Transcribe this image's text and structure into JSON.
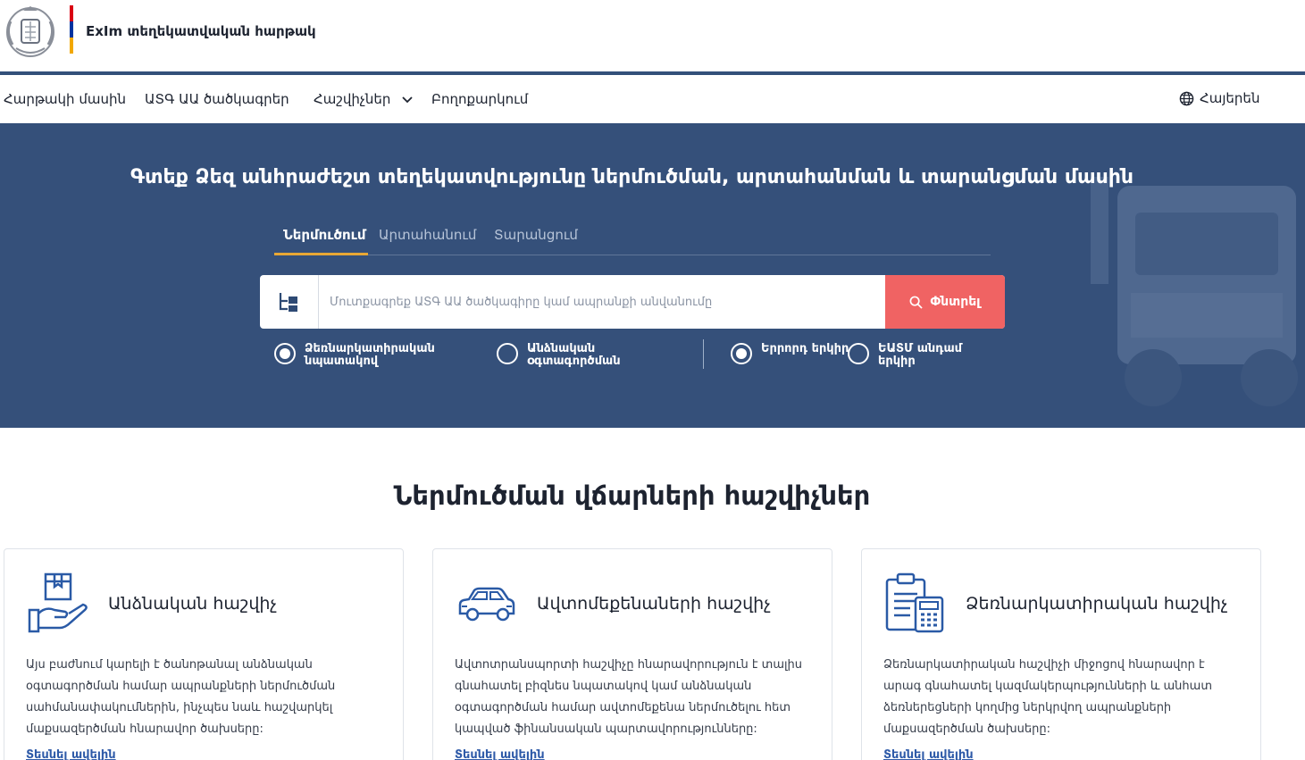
{
  "header": {
    "site_title": "ExIm տեղեկատվական հարթակ",
    "flag_colors": [
      "#d90012",
      "#0033a0",
      "#f2a800"
    ]
  },
  "nav": {
    "items": [
      {
        "label": "Հարթակի մասին"
      },
      {
        "label": "ԱՏԳ ԱԱ ծածկագրեր"
      },
      {
        "label": "Հաշվիչներ"
      },
      {
        "label": "Բողոքարկում"
      }
    ],
    "language": "Հայերեն"
  },
  "hero": {
    "title": "Գտեք Ձեզ անհրաժեշտ տեղեկատվությունը ներմուծման, արտահանման և տարանցման մասին",
    "tabs": [
      "Ներմուծում",
      "Արտահանում",
      "Տարանցում"
    ],
    "active_tab": "Ներմուծում",
    "search": {
      "placeholder": "Մուտքագրեք ԱՏԳ ԱԱ ծածկագիրը կամ ապրանքի անվանումը",
      "value": "",
      "button_label": "Փնտրել"
    },
    "purpose_options": [
      {
        "label": "Ձեռնարկատիրական նպատակով",
        "checked": true
      },
      {
        "label": "Անձնական օգտագործման",
        "checked": false
      }
    ],
    "origin_options": [
      {
        "label": "Երրորդ երկիր",
        "checked": true
      },
      {
        "label": "ԵԱՏՄ անդամ երկիր",
        "checked": false
      }
    ]
  },
  "section": {
    "title": "Ներմուծման վճարների հաշվիչներ"
  },
  "cards": [
    {
      "icon": "hand-package-icon",
      "title": "Անձնական հաշվիչ",
      "body": "Այս բաժնում կարելի է ծանոթանալ անձնական օգտագործման համար ապրանքների ներմուծման սահմանափակումներին, ինչպես նաև հաշվարկել մաքսազերծման հնարավոր ծախսերը:",
      "link": "Տեսնել ավելին"
    },
    {
      "icon": "car-icon",
      "title": "Ավտոմեքենաների հաշվիչ",
      "body": "Ավտոտրանսպորտի հաշվիչը հնարավորություն է տալիս գնահատել բիզնես նպատակով կամ անձնական օգտագործման համար ավտոմեքենա ներմուծելու հետ կապված ֆինանսական պարտավորությունները:",
      "link": "Տեսնել ավելին"
    },
    {
      "icon": "clipboard-calculator-icon",
      "title": "Ձեռնարկատիրական հաշվիչ",
      "body": "Ձեռնարկատիրական հաշվիչի միջոցով հնարավոր է արագ գնահատել կազմակերպությունների և անհատ ձեռներեցների կողմից ներկրվող ապրանքների մաքսազերծման ծախսերը:",
      "link": "Տեսնել ավելին"
    }
  ]
}
